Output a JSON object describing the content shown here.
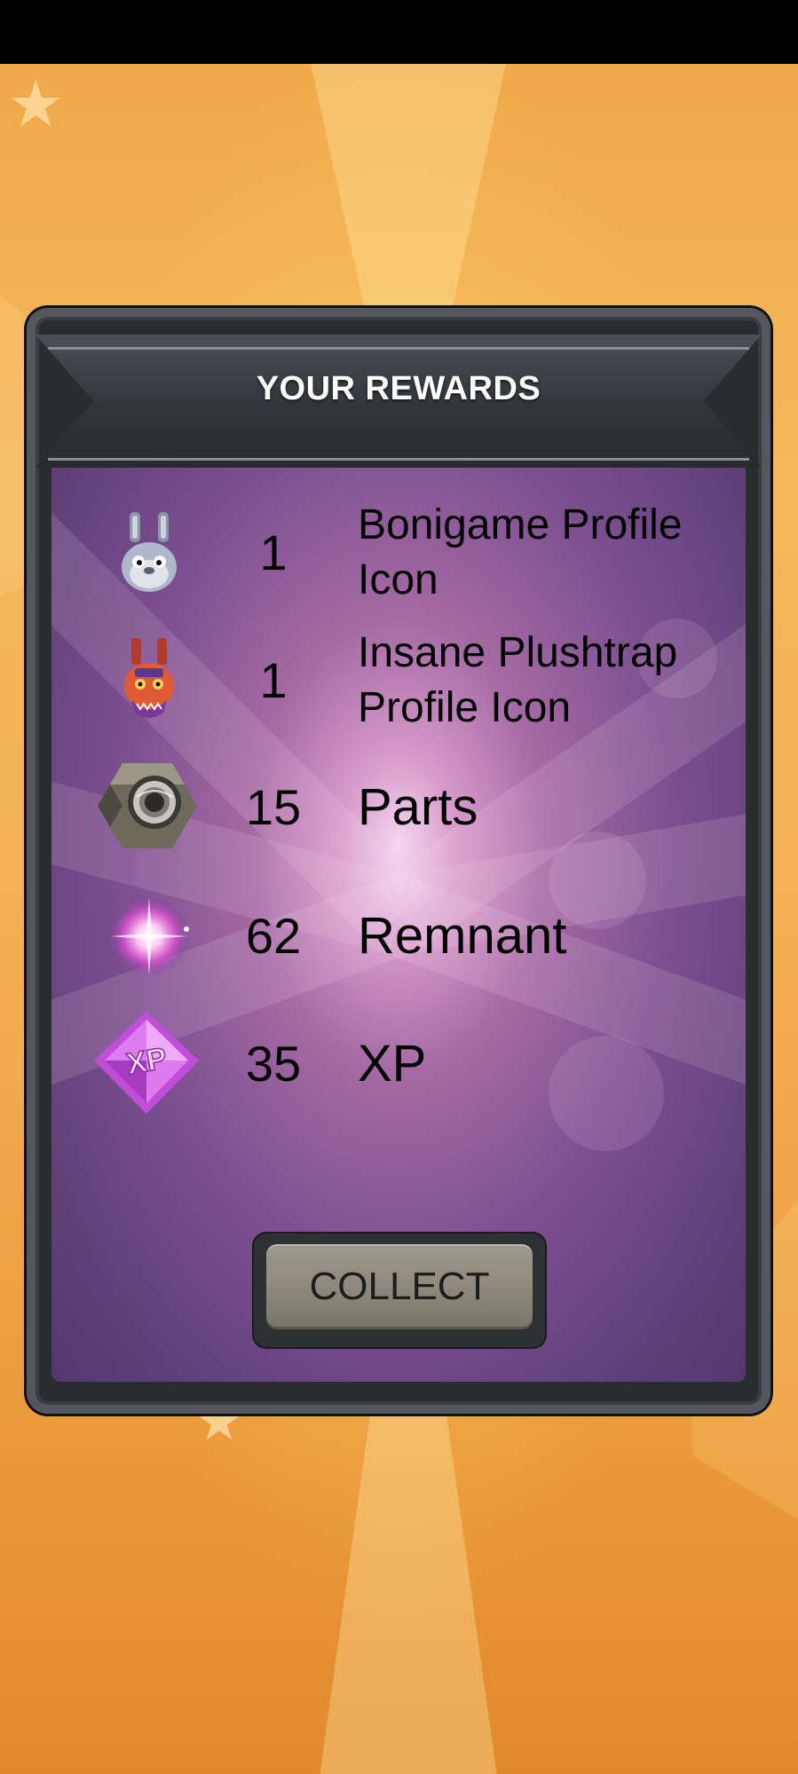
{
  "dialog": {
    "title": "YOUR REWARDS",
    "collect_label": "COLLECT"
  },
  "rewards": [
    {
      "quantity": "1",
      "name": "Bonigame Profile Icon",
      "icon": "bonnie-profile-icon"
    },
    {
      "quantity": "1",
      "name": "Insane Plushtrap Profile Icon",
      "icon": "plushtrap-profile-icon"
    },
    {
      "quantity": "15",
      "name": "Parts",
      "icon": "hex-nut-icon"
    },
    {
      "quantity": "62",
      "name": "Remnant",
      "icon": "remnant-orb-icon"
    },
    {
      "quantity": "35",
      "name": "XP",
      "icon": "xp-gem-icon"
    }
  ],
  "xp_icon_text": "XP",
  "colors": {
    "background": "#f0a94b",
    "panel_frame": "#2a2c30",
    "panel_inner": "#7e5090",
    "button": "#8a8779"
  }
}
